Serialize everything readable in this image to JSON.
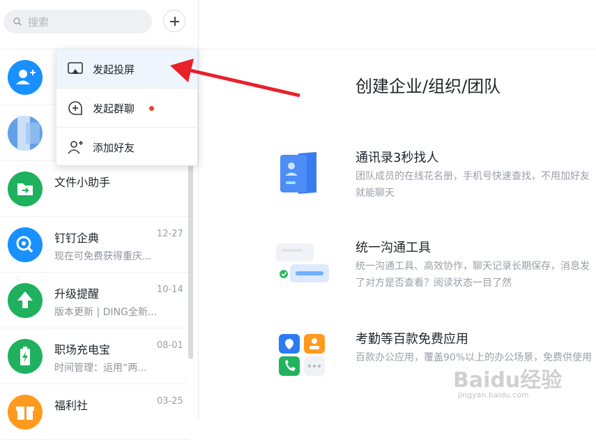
{
  "search": {
    "placeholder": "搜索"
  },
  "popup_menu": {
    "items": [
      {
        "label": "发起投屏",
        "icon": "screen-cast-icon"
      },
      {
        "label": "发起群聊",
        "icon": "group-chat-icon",
        "badge": "red-dot"
      },
      {
        "label": "添加好友",
        "icon": "add-friend-icon"
      }
    ]
  },
  "conversations": [
    {
      "name": "",
      "preview": "",
      "time": "",
      "avatar": "person-add-icon",
      "avatar_color": "#1890ff"
    },
    {
      "name": "",
      "preview": "",
      "time": "",
      "avatar": "blurred-avatar",
      "avatar_color": "#4a90e2"
    },
    {
      "name": "文件小助手",
      "preview": "",
      "time": "",
      "avatar": "folder-icon",
      "avatar_color": "#1fb15e"
    },
    {
      "name": "钉钉企典",
      "preview": "现在可免费获得重庆...",
      "time": "12-27",
      "avatar": "search-company-icon",
      "avatar_color": "#1890ff"
    },
    {
      "name": "升级提醒",
      "preview": "版本更新 | DING全新...",
      "time": "10-14",
      "avatar": "upload-arrow-icon",
      "avatar_color": "#1fb15e"
    },
    {
      "name": "职场充电宝",
      "preview": "时间管理：运用“两...",
      "time": "08-01",
      "avatar": "battery-icon",
      "avatar_color": "#1fb15e"
    },
    {
      "name": "福利社",
      "preview": "",
      "time": "03-25",
      "avatar": "gift-icon",
      "avatar_color": "#ff9a1f"
    }
  ],
  "main": {
    "title": "创建企业/组织/团队",
    "features": [
      {
        "title": "通讯录3秒找人",
        "desc": "团队成员的在线花名册，手机号快速查找，不用加好友就能聊天"
      },
      {
        "title": "统一沟通工具",
        "desc": "统一沟通工具、高效协作，聊天记录长期保存，消息发了对方是否查看？阅读状态一目了然"
      },
      {
        "title": "考勤等百款免费应用",
        "desc": "百款办公应用，覆盖90%以上的办公场景，免费供使用"
      }
    ]
  },
  "watermark": {
    "brand": "Baidu经验",
    "url": "jingyan.baidu.com"
  },
  "colors": {
    "accent": "#1890ff",
    "green": "#1fb15e",
    "orange": "#ff9a1f",
    "arrow": "#e8202a"
  }
}
